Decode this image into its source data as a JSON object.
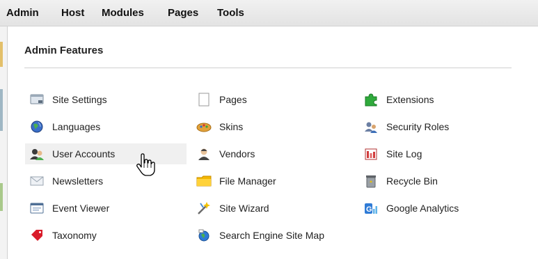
{
  "menu": {
    "items": [
      {
        "label": "Admin"
      },
      {
        "label": "Host"
      },
      {
        "label": "Modules"
      },
      {
        "label": "Pages"
      },
      {
        "label": "Tools"
      }
    ]
  },
  "panel": {
    "title": "Admin Features",
    "columns": [
      [
        {
          "label": "Site Settings",
          "icon": "site-settings-icon"
        },
        {
          "label": "Languages",
          "icon": "languages-globe-icon"
        },
        {
          "label": "User Accounts",
          "icon": "user-accounts-icon",
          "hovered": true
        },
        {
          "label": "Newsletters",
          "icon": "envelope-icon"
        },
        {
          "label": "Event Viewer",
          "icon": "event-viewer-icon"
        },
        {
          "label": "Taxonomy",
          "icon": "tag-icon"
        }
      ],
      [
        {
          "label": "Pages",
          "icon": "page-icon"
        },
        {
          "label": "Skins",
          "icon": "palette-icon"
        },
        {
          "label": "Vendors",
          "icon": "vendors-icon"
        },
        {
          "label": "File Manager",
          "icon": "folder-icon"
        },
        {
          "label": "Site Wizard",
          "icon": "wizard-wand-icon"
        },
        {
          "label": "Search Engine Site Map",
          "icon": "sitemap-globe-icon"
        }
      ],
      [
        {
          "label": "Extensions",
          "icon": "puzzle-piece-icon"
        },
        {
          "label": "Security Roles",
          "icon": "security-roles-icon"
        },
        {
          "label": "Site Log",
          "icon": "site-log-icon"
        },
        {
          "label": "Recycle Bin",
          "icon": "recycle-bin-icon"
        },
        {
          "label": "Google Analytics",
          "icon": "google-analytics-icon"
        }
      ]
    ]
  },
  "colors": {
    "menubar": "#e8e8e8",
    "hover_row": "#f0f0f0",
    "divider": "#cfcfcf"
  }
}
